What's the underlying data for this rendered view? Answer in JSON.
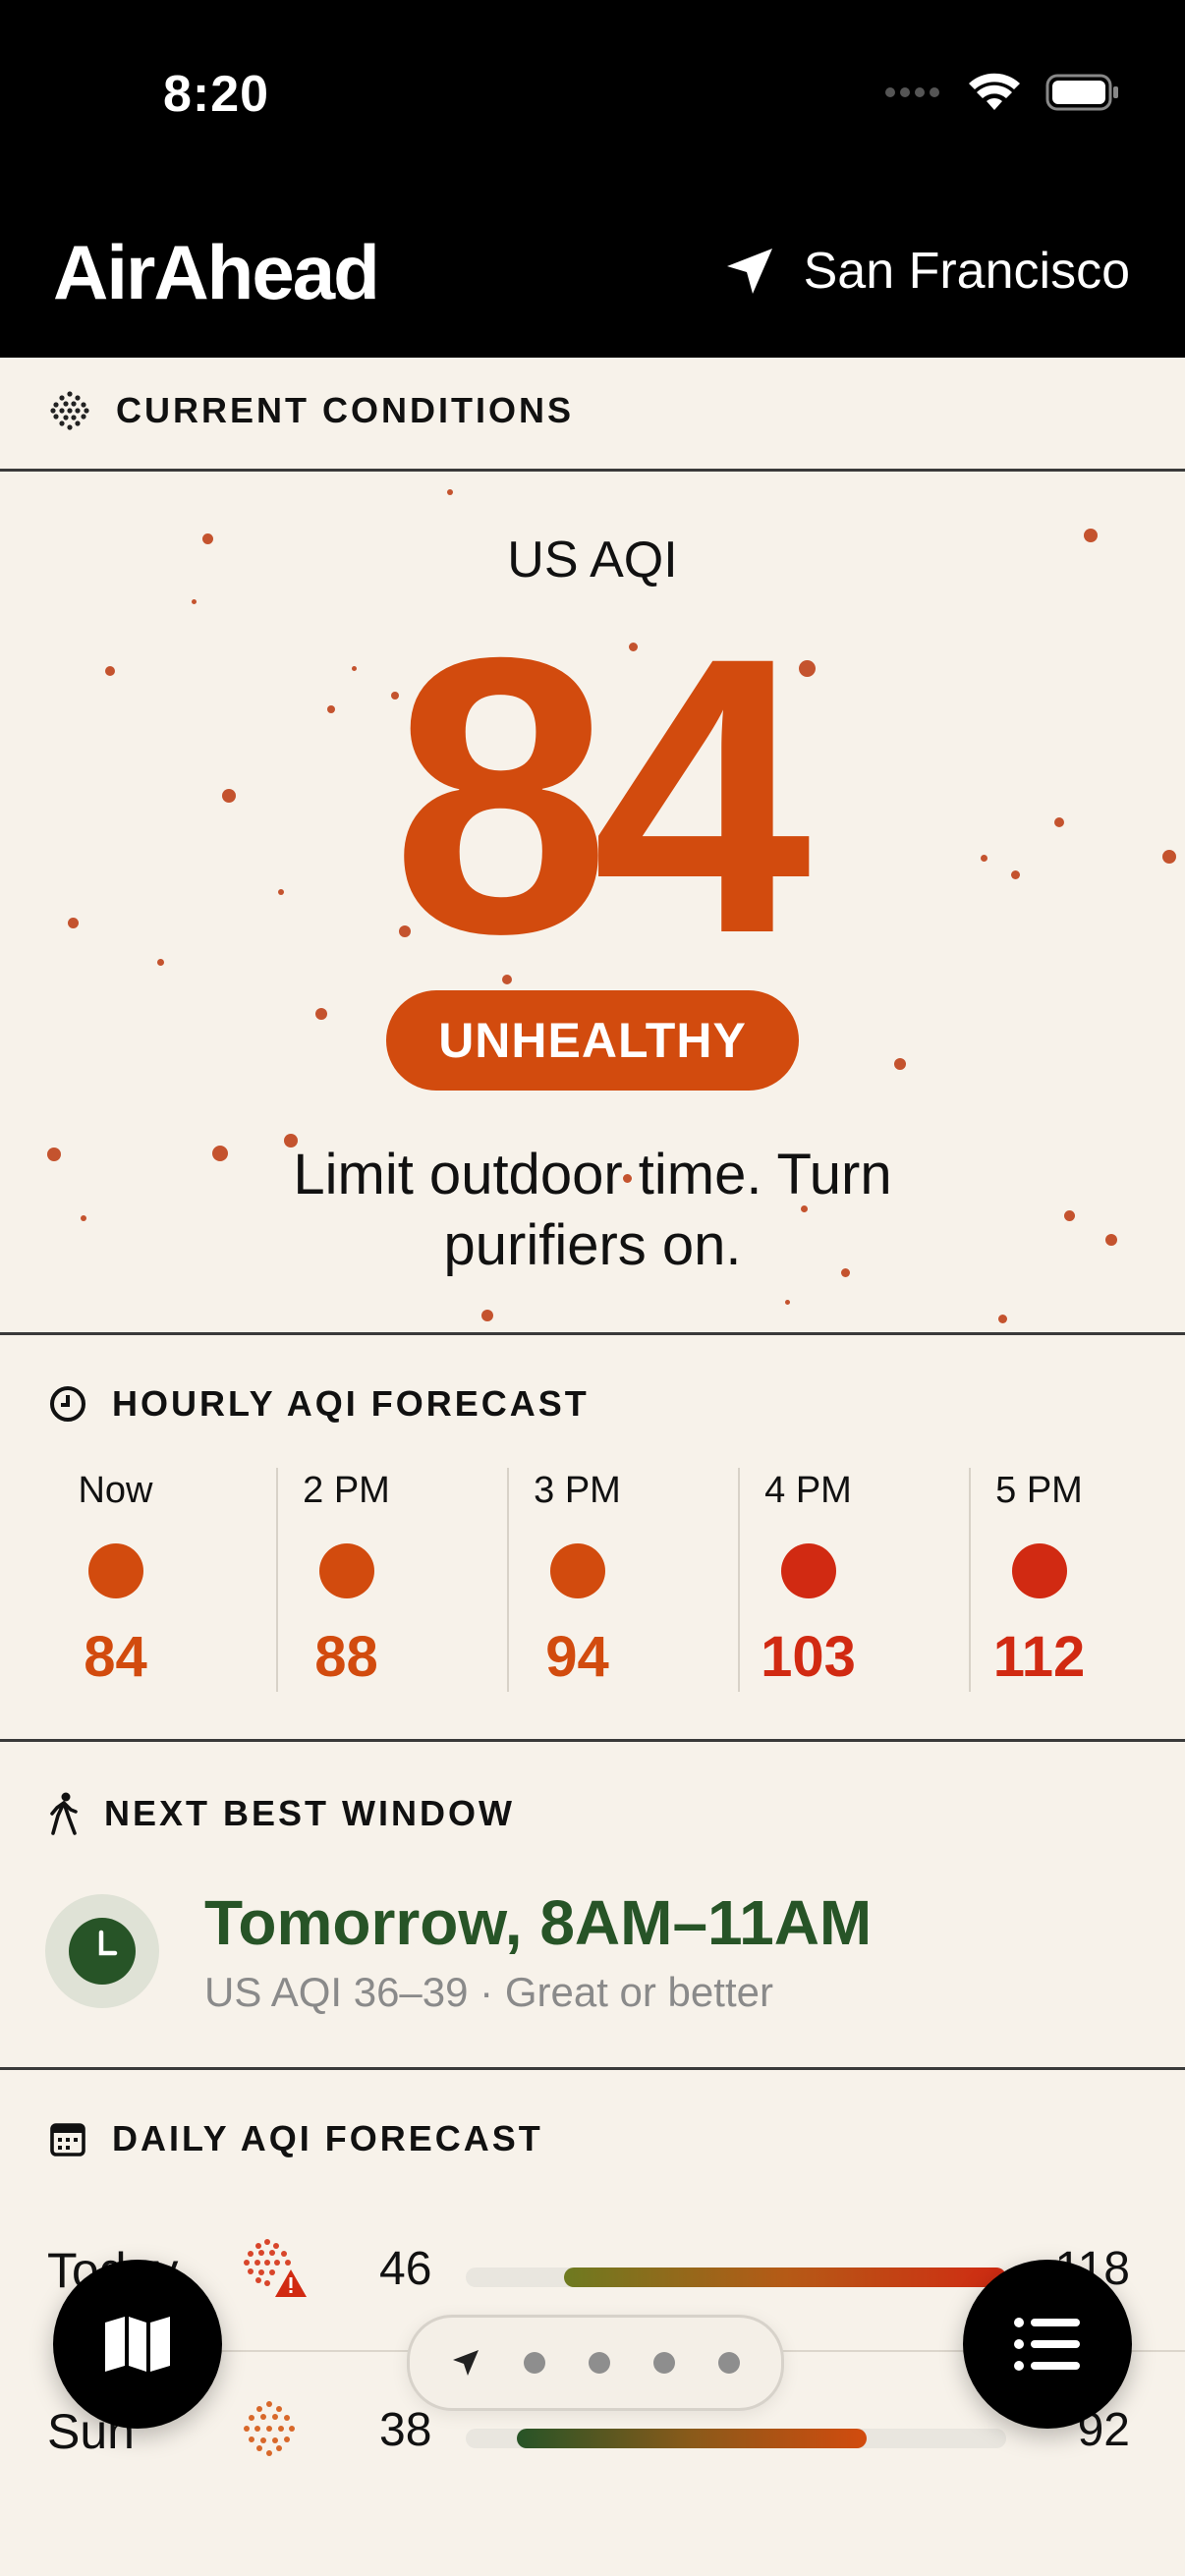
{
  "status_bar": {
    "time": "8:20"
  },
  "header": {
    "app_title": "AirAhead",
    "location": "San Francisco"
  },
  "current": {
    "section_label": "CURRENT CONDITIONS",
    "aqi_unit": "US AQI",
    "aqi_value": "84",
    "category": "UNHEALTHY",
    "advice": "Limit outdoor time. Turn purifiers on.",
    "accent_color": "#d24b0e"
  },
  "hourly": {
    "section_label": "HOURLY AQI FORECAST",
    "items": [
      {
        "time": "Now",
        "value": "84",
        "color": "#d24b0e"
      },
      {
        "time": "2 PM",
        "value": "88",
        "color": "#d24b0e"
      },
      {
        "time": "3 PM",
        "value": "94",
        "color": "#d24b0e"
      },
      {
        "time": "4 PM",
        "value": "103",
        "color": "#d12a12"
      },
      {
        "time": "5 PM",
        "value": "112",
        "color": "#d12a12"
      }
    ]
  },
  "best_window": {
    "section_label": "NEXT BEST WINDOW",
    "title": "Tomorrow, 8AM–11AM",
    "subtitle": "US AQI 36–39 · Great or better",
    "color": "#275427"
  },
  "daily": {
    "section_label": "DAILY AQI FORECAST",
    "rows": [
      {
        "day": "Today",
        "low": "46",
        "high": "118",
        "icon": "particles-warning-icon"
      },
      {
        "day": "Sun",
        "low": "38",
        "high": "92",
        "icon": "particles-icon"
      }
    ]
  },
  "nav": {
    "map_icon": "map-icon",
    "list_icon": "list-icon",
    "pages": 5,
    "current_page": 1
  }
}
